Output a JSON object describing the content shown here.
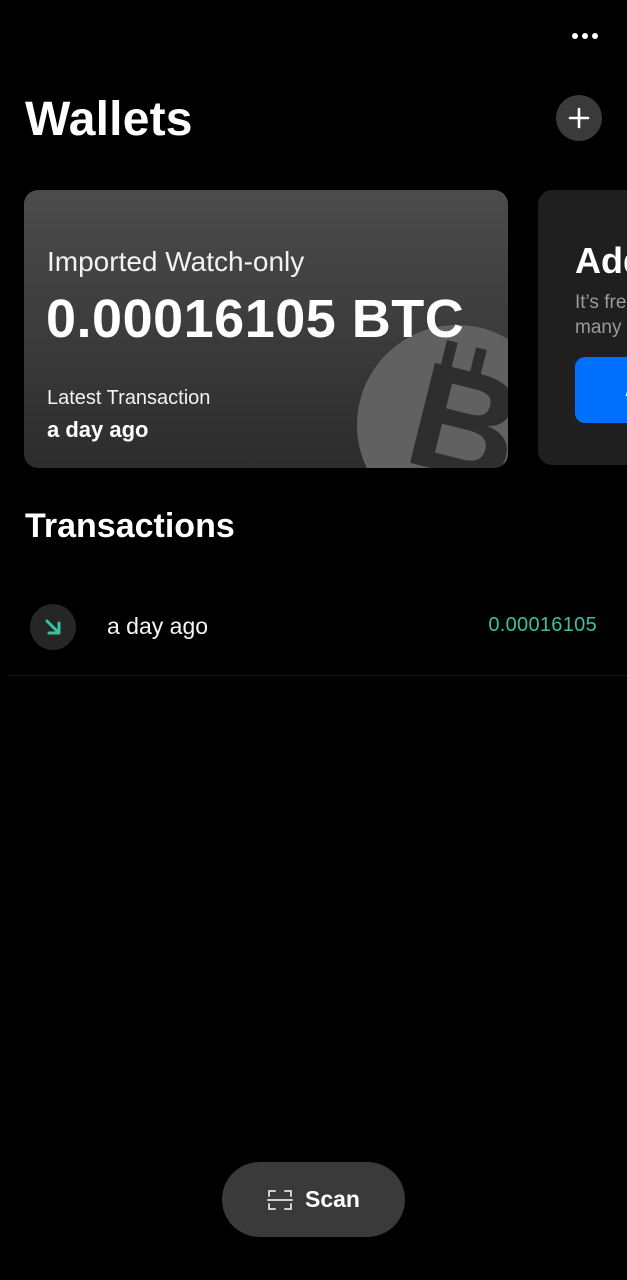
{
  "header": {
    "title": "Wallets"
  },
  "wallet_card": {
    "label": "Imported Watch-only",
    "balance": "0.00016105 BTC",
    "latest_label": "Latest Transaction",
    "latest_value": "a day ago"
  },
  "add_wallet_card": {
    "title": "Add",
    "text": "It’s free and you can create as many",
    "button_label": "Add now"
  },
  "transactions": {
    "title": "Transactions",
    "items": [
      {
        "time": "a day ago",
        "amount": "0.00016105",
        "direction": "incoming"
      }
    ]
  },
  "scan": {
    "label": "Scan"
  },
  "icons": {
    "more": "more-horizontal-icon",
    "add": "plus-icon",
    "coin": "bitcoin-icon",
    "tx": "arrow-down-right-icon",
    "scan": "scan-icon"
  },
  "colors": {
    "background": "#000000",
    "card_gradient_top": "#4c4c4c",
    "card_gradient_bottom": "#2c2c2c",
    "accent_blue": "#0070ff",
    "incoming_green": "#37c0a1"
  }
}
